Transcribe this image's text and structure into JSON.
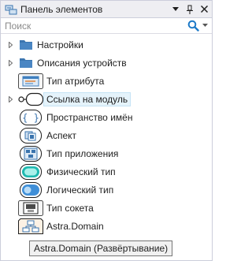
{
  "panel": {
    "title": "Панель элементов",
    "buttons": {
      "dropdown": "▼",
      "pin": "pin",
      "close": "✕"
    }
  },
  "search": {
    "placeholder": "Поиск",
    "value": ""
  },
  "items": [
    {
      "label": "Настройки",
      "kind": "folder",
      "expandable": true,
      "icon": "folder-icon"
    },
    {
      "label": "Описания устройств",
      "kind": "folder",
      "expandable": true,
      "icon": "folder-icon"
    },
    {
      "label": "Тип атрибута",
      "kind": "item",
      "expandable": false,
      "icon": "attribute-type-icon"
    },
    {
      "label": "Ссылка на модуль",
      "kind": "item",
      "expandable": true,
      "icon": "module-link-icon"
    },
    {
      "label": "Пространство имён",
      "kind": "item",
      "expandable": false,
      "icon": "namespace-icon"
    },
    {
      "label": "Аспект",
      "kind": "item",
      "expandable": false,
      "icon": "aspect-icon"
    },
    {
      "label": "Тип приложения",
      "kind": "item",
      "expandable": false,
      "icon": "application-type-icon"
    },
    {
      "label": "Физический тип",
      "kind": "item",
      "expandable": false,
      "icon": "physical-type-icon"
    },
    {
      "label": "Логический тип",
      "kind": "item",
      "expandable": false,
      "icon": "logical-type-icon"
    },
    {
      "label": "Тип сокета",
      "kind": "item",
      "expandable": false,
      "icon": "socket-type-icon"
    },
    {
      "label": "Astra.Domain",
      "kind": "item",
      "expandable": false,
      "icon": "astra-domain-icon"
    }
  ],
  "tooltip": {
    "text": "Astra.Domain (Развёртывание)"
  },
  "colors": {
    "accent": "#1e7ac8",
    "folder": "#3c76b0",
    "hover": "#e5f3fb"
  }
}
